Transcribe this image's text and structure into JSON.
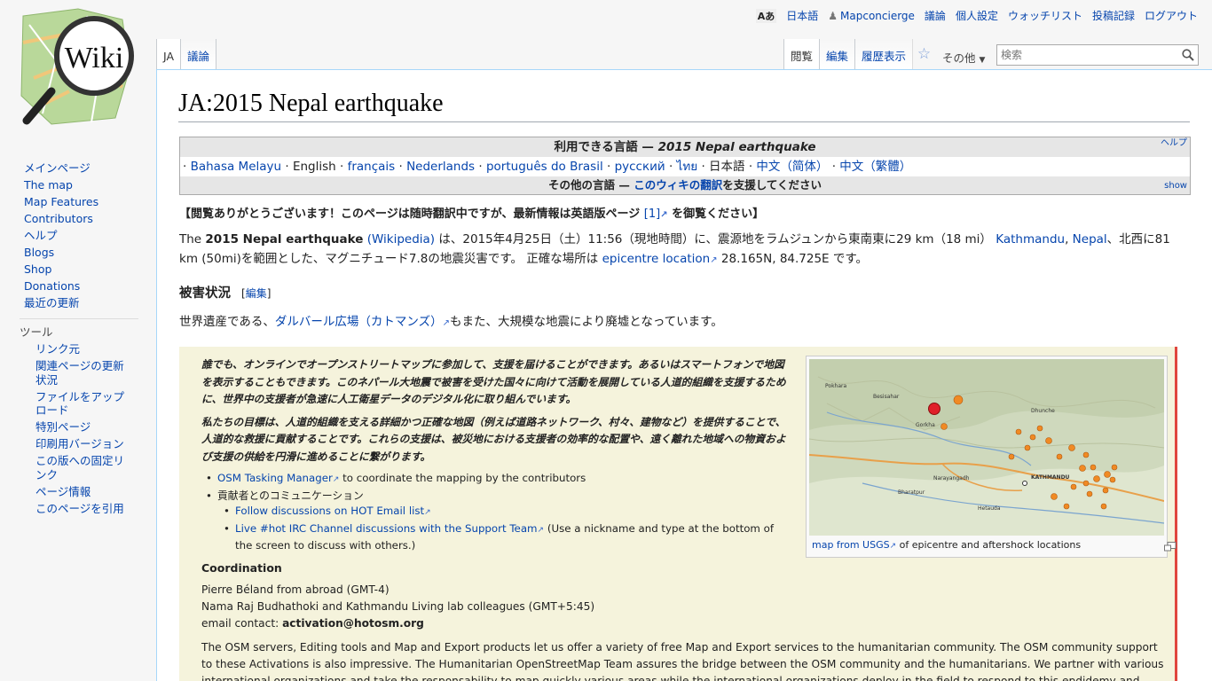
{
  "personal": {
    "lang_icon": "translate-icon",
    "lang": "日本語",
    "user": "Mapconcierge",
    "talk": "議論",
    "prefs": "個人設定",
    "watchlist": "ウォッチリスト",
    "contribs": "投稿記録",
    "logout": "ログアウト"
  },
  "logo_text": "Wiki",
  "tabs_left": [
    "JA",
    "議論"
  ],
  "tabs_right": [
    "閲覧",
    "編集",
    "履歴表示"
  ],
  "more": "その他",
  "search": {
    "placeholder": "検索"
  },
  "sidebar": {
    "nav": [
      "メインページ",
      "The map",
      "Map Features",
      "Contributors",
      "ヘルプ",
      "Blogs",
      "Shop",
      "Donations",
      "最近の更新"
    ],
    "tools_heading": "ツール",
    "tools": [
      "リンク元",
      "関連ページの更新状況",
      "ファイルをアップロード",
      "特別ページ",
      "印刷用バージョン",
      "この版への固定リンク",
      "ページ情報",
      "このページを引用"
    ]
  },
  "title": "JA:2015 Nepal earthquake",
  "langbox": {
    "header_prefix": "利用できる言語 — ",
    "header_page": "2015 Nepal earthquake",
    "help": "ヘルプ",
    "languages": [
      "Bahasa Melayu",
      "English",
      "français",
      "Nederlands",
      "português do Brasil",
      "русский",
      "ไทย",
      "日本語",
      "中文（简体）",
      "中文（繁體）"
    ],
    "footer_prefix": "その他の言語 — ",
    "footer_link": "このウィキの翻訳",
    "footer_suffix": "を支援してください",
    "show": "show"
  },
  "notice": {
    "text": "【閲覧ありがとうございます！このページは随時翻訳中ですが、最新情報は英語版ページ",
    "link": "[1]",
    "end": "を御覧ください】"
  },
  "intro": {
    "t1": "The ",
    "bold": "2015 Nepal earthquake",
    "wiki": "(Wikipedia)",
    "t2": " は、2015年4月25日（土）11:56（現地時間）に、震源地をラムジュンから東南東に29 km（18 mi）",
    "kathmandu": "Kathmandu",
    "nepal": "Nepal",
    "t3": "、北西に81 km (50mi)を範囲とした、マグニチュード7.8の地震災害です。 正確な場所は",
    "epicentre": "epicentre location",
    "t4": " 28.165N, 84.725E です。"
  },
  "section": {
    "heading": "被害状況",
    "edit": "編集"
  },
  "damage": {
    "t1": "世界遺産である、",
    "link": "ダルバール広場（カトマンズ）",
    "t2": "もまた、大規模な地震により廃墟となっています。"
  },
  "hot": {
    "p1": "誰でも、オンラインでオープンストリートマップに参加して、支援を届けることができます。あるいはスマートフォンで地図を表示することもできます。このネパール大地震で被害を受けた国々に向けて活動を展開している人道的組織を支援するために、世界中の支援者が急速に人工衛星データのデジタル化に取り組んでいます。",
    "p2": "私たちの目標は、人道的組織を支える詳細かつ正確な地図（例えば道路ネットワーク、村々、建物など）を提供することで、人道的な救援に貢献することです。これらの支援は、被災地における支援者の効率的な配置や、遠く離れた地域への物資および支援の供給を円滑に進めることに繋がります。",
    "b1_link": "OSM Tasking Manager",
    "b1_text": " to coordinate the mapping by the contributors",
    "b2": "貢献者とのコミュニケーション",
    "s1_link": "Follow discussions on HOT Email list",
    "s2_link": "Live #hot IRC Channel discussions with the Support Team",
    "s2_text": " (Use a nickname and type at the bottom of the screen to discuss with others.)",
    "coord": "Coordination",
    "c1": "Pierre Béland from abroad (GMT-4)",
    "c2": "Nama Raj Budhathoki and Kathmandu Living lab colleagues (GMT+5:45)",
    "c3_prefix": "email contact: ",
    "c3_email": "activation@hotosm.org",
    "long": "The OSM servers, Editing tools and Map and Export products let us offer a variety of free Map and Export services to the humanitarian community. The OSM community support to these Activations is also impressive. The Humanitarian OpenStreetMap Team assures the bridge between the OSM community and the humanitarians. We partner with various international organizations and take the responsability to map quickly various areas while the international organizations deploy in the field to respond to this epdidemy and support the"
  },
  "thumb": {
    "cap_link": "map from USGS",
    "cap_text": " of epicentre and aftershock locations",
    "labels": [
      "Pokhara",
      "KATHMANDU",
      "Gorkha",
      "Besisahar",
      "Dhunche",
      "Narayangadh",
      "Hetauda",
      "Bharatpur"
    ]
  },
  "colors": {
    "link": "#0645ad",
    "hotbox_bg": "#f5f3dc",
    "hotbox_border": "#e0463f",
    "epicentre": "#e0202a",
    "aftershock": "#f08a24"
  }
}
